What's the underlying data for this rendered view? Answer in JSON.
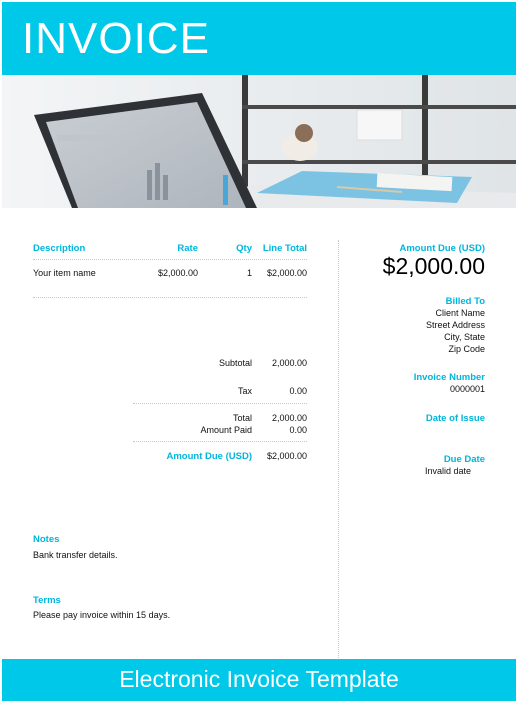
{
  "header": {
    "title": "INVOICE"
  },
  "colors": {
    "accent": "#00c8e8",
    "accent_text": "#00b6dc"
  },
  "table": {
    "headers": {
      "description": "Description",
      "rate": "Rate",
      "qty": "Qty",
      "line_total": "Line Total"
    },
    "rows": [
      {
        "description": "Your item name",
        "rate": "$2,000.00",
        "qty": "1",
        "line_total": "$2,000.00"
      }
    ]
  },
  "totals": {
    "subtotal_label": "Subtotal",
    "subtotal_value": "2,000.00",
    "tax_label": "Tax",
    "tax_value": "0.00",
    "total_label": "Total",
    "total_value": "2,000.00",
    "amount_paid_label": "Amount Paid",
    "amount_paid_value": "0.00",
    "amount_due_label": "Amount Due (USD)",
    "amount_due_value": "$2,000.00"
  },
  "notes": {
    "label": "Notes",
    "text": "Bank transfer details."
  },
  "terms": {
    "label": "Terms",
    "text": "Please pay invoice within 15 days."
  },
  "summary": {
    "amount_due_label": "Amount Due (USD)",
    "amount_due_value": "$2,000.00",
    "billed_to_label": "Billed To",
    "client_name": "Client Name",
    "street_address": "Street Address",
    "city_state": "City, State",
    "zip_code": "Zip Code",
    "invoice_number_label": "Invoice Number",
    "invoice_number": "0000001",
    "date_of_issue_label": "Date of Issue",
    "due_date_label": "Due Date",
    "due_date_value": "Invalid date"
  },
  "footer": {
    "title": "Electronic Invoice Template"
  }
}
